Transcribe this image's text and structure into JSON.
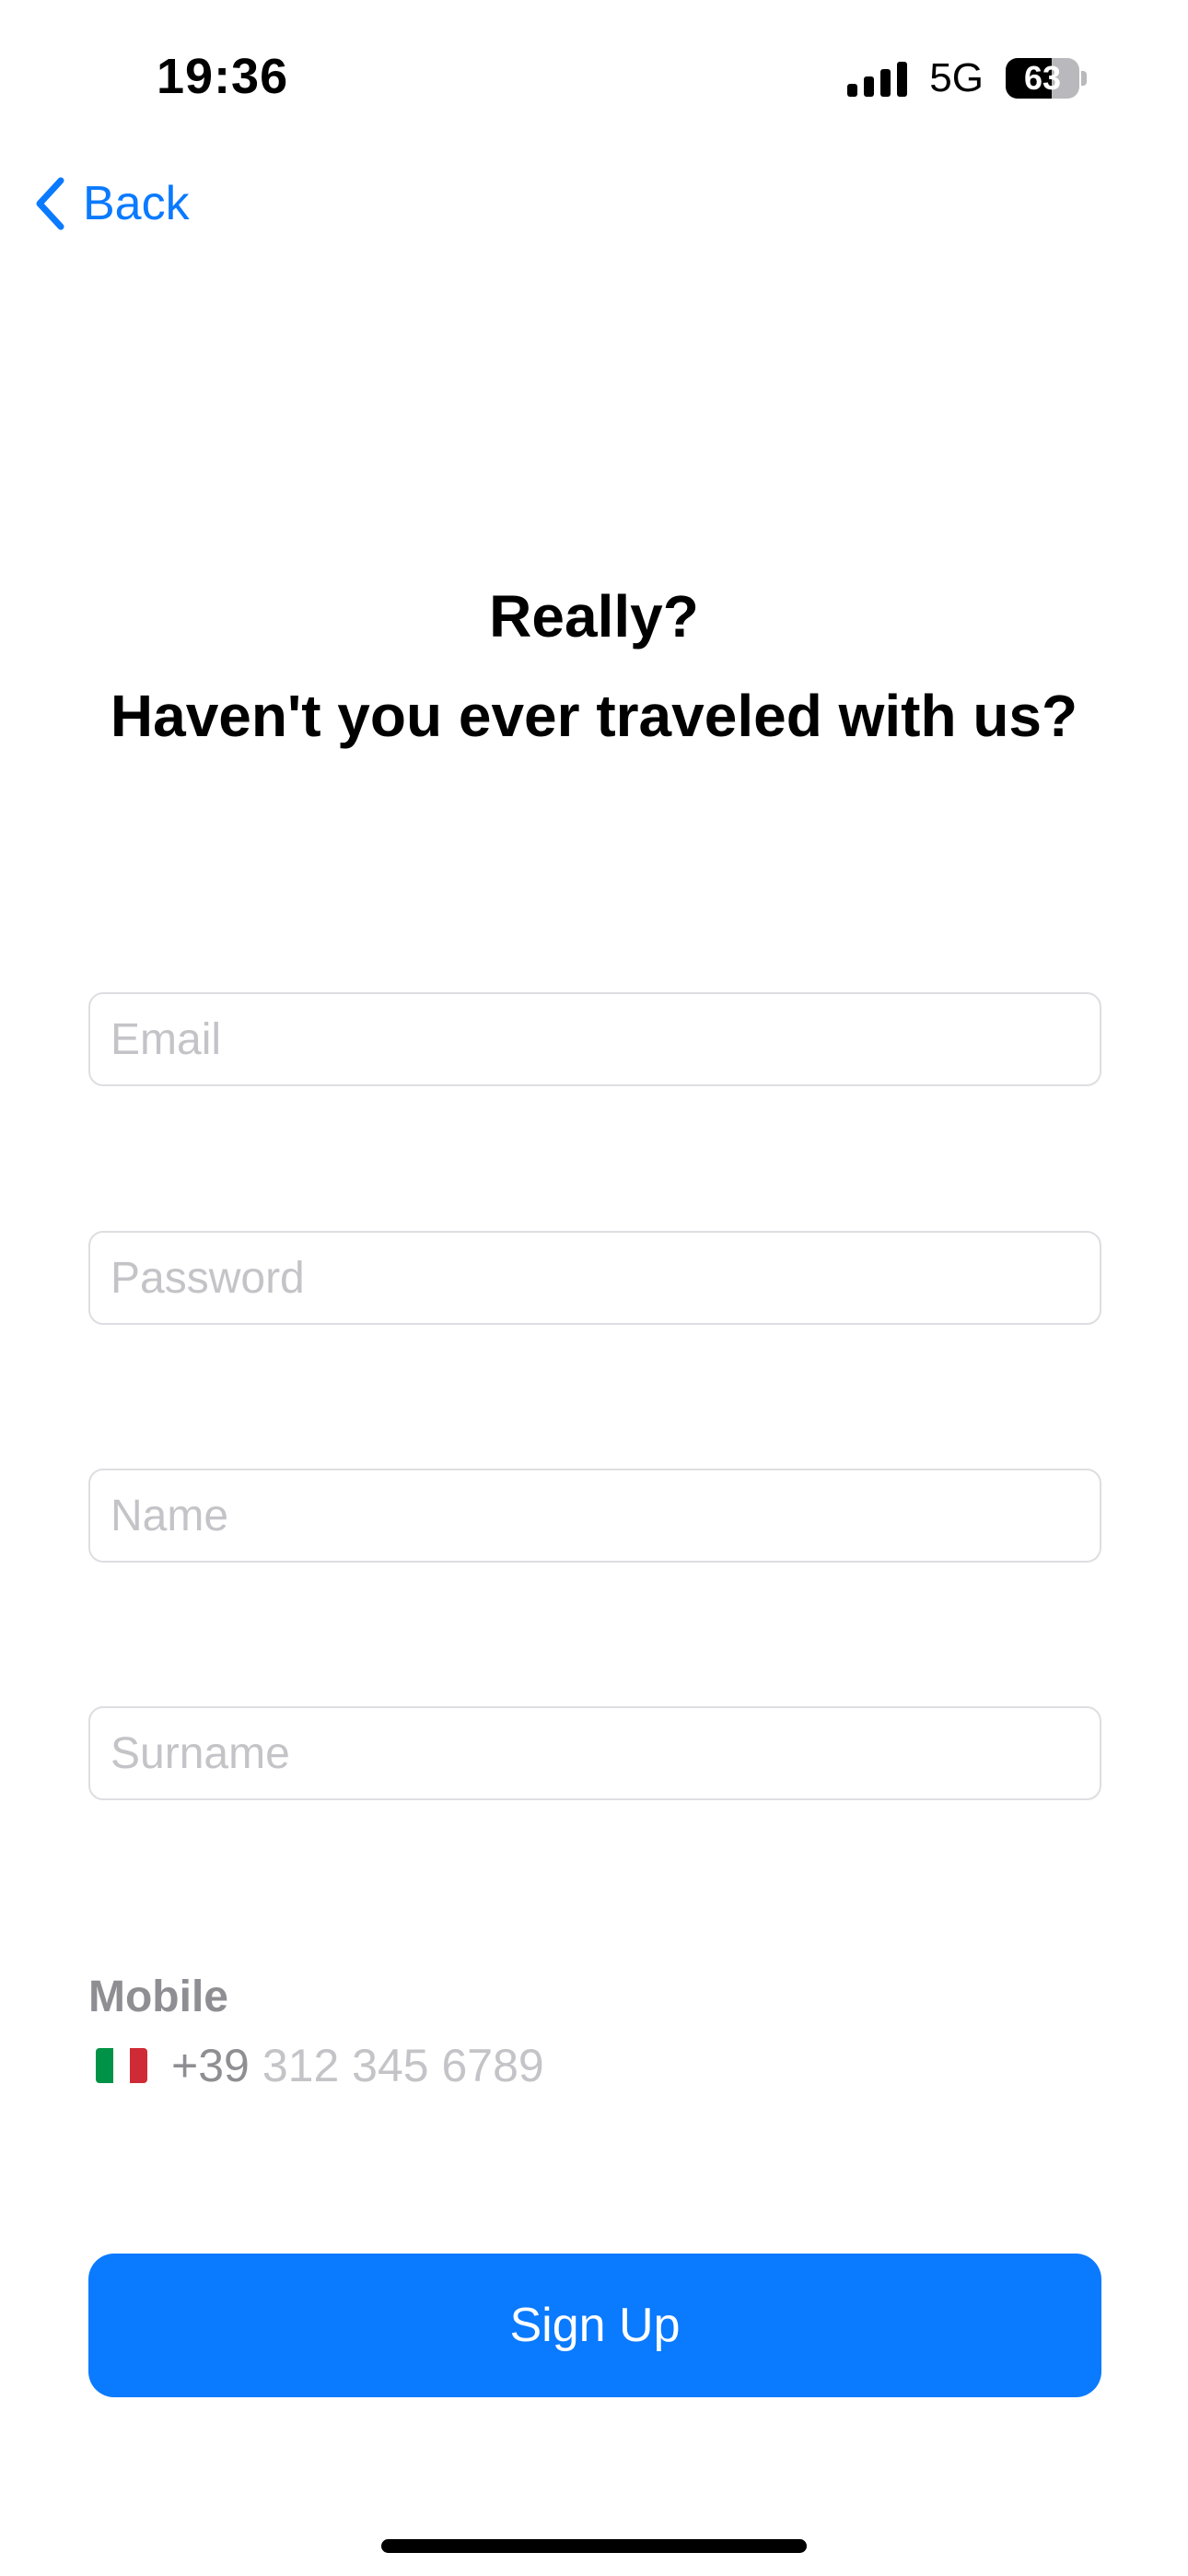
{
  "status_bar": {
    "time": "19:36",
    "network": "5G",
    "battery_level": "63",
    "battery_fraction": 0.63,
    "signal_icon": "cellular-signal-icon",
    "battery_icon": "battery-icon"
  },
  "nav": {
    "back_label": "Back",
    "back_icon": "chevron-left-icon"
  },
  "header": {
    "line1": "Really?",
    "line2": "Haven't you ever traveled with us?"
  },
  "form": {
    "email_placeholder": "Email",
    "password_placeholder": "Password",
    "name_placeholder": "Name",
    "surname_placeholder": "Surname",
    "mobile_label": "Mobile",
    "country_flag": "italy-flag-icon",
    "country_prefix": "+39",
    "phone_placeholder": "312 345 6789"
  },
  "actions": {
    "signup_label": "Sign Up"
  },
  "colors": {
    "accent": "#0a7aff",
    "placeholder": "#c4c4c8",
    "secondary_text": "#8e8e93",
    "field_border": "#dedee2"
  }
}
